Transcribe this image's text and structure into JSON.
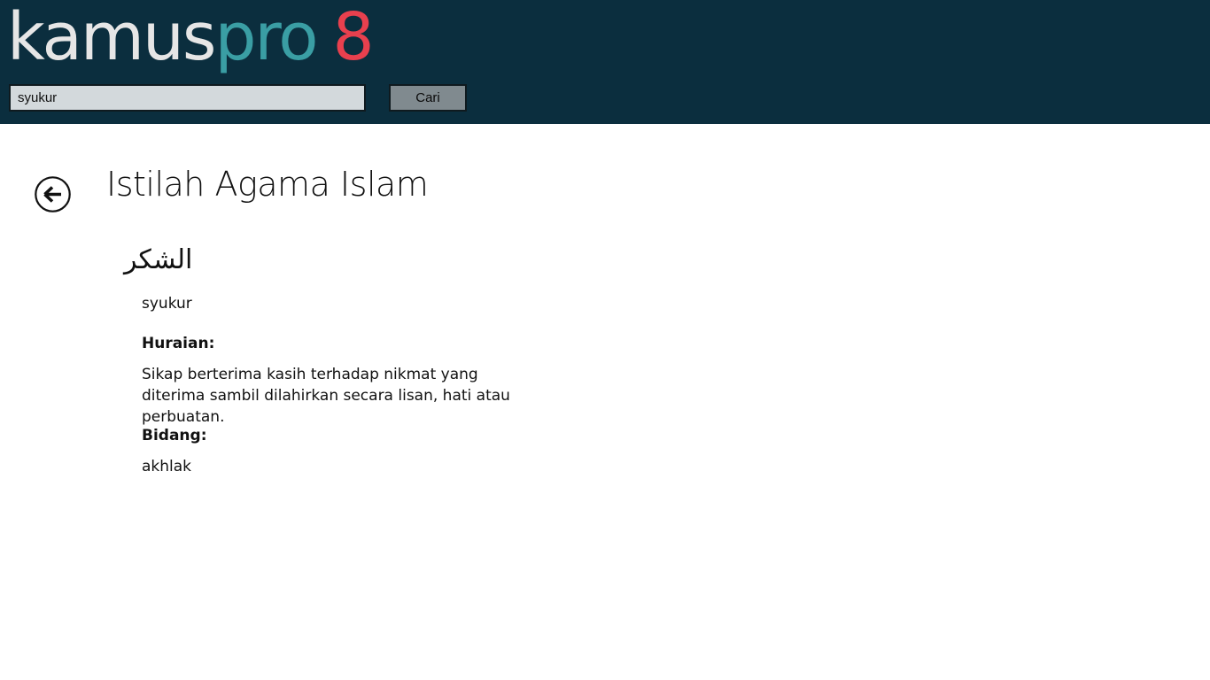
{
  "header": {
    "logo": {
      "part1": "kamus",
      "part2": "pro",
      "part3": "8",
      "colors": {
        "part1": "#e6e6e6",
        "part2": "#3a9ea4",
        "part3": "#e8404e"
      }
    },
    "background": "#0b2e3e",
    "search": {
      "value": "syukur",
      "placeholder": ""
    },
    "search_button_label": "Cari"
  },
  "main": {
    "back_icon": "arrow-left-circle-icon",
    "title": "Istilah Agama Islam",
    "entry": {
      "arabic": "الشكر",
      "term": "syukur",
      "description_label": "Huraian:",
      "description": "Sikap berterima kasih terhadap nikmat yang diterima sambil dilahirkan secara lisan, hati atau perbuatan.",
      "field_label": "Bidang:",
      "field": "akhlak"
    }
  }
}
